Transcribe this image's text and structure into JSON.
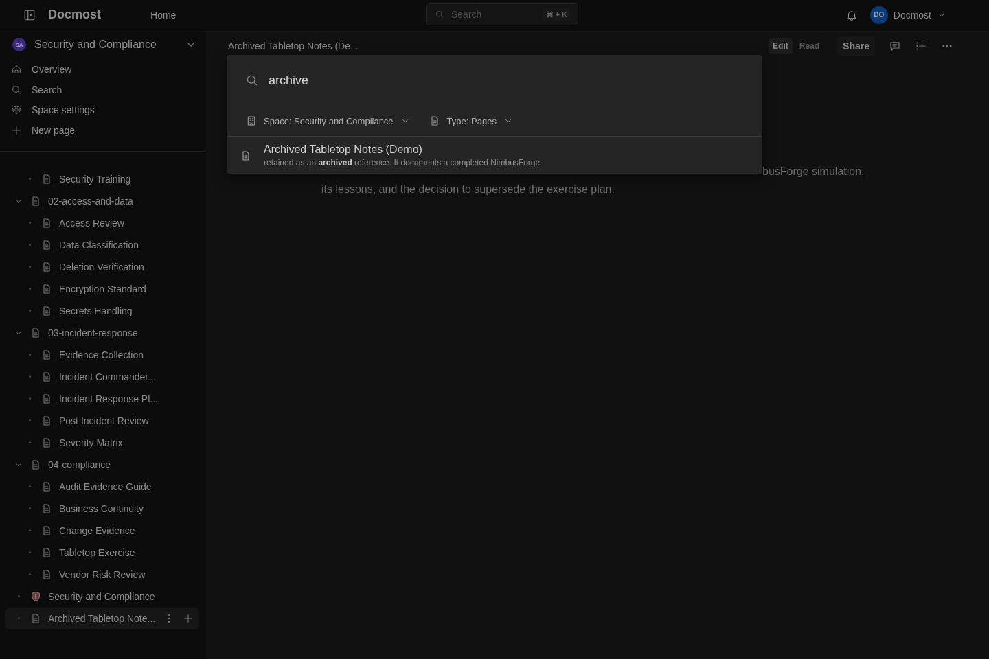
{
  "topbar": {
    "app_name": "Docmost",
    "nav": [
      {
        "label": "Home"
      }
    ],
    "search": {
      "placeholder": "Search",
      "shortcut": "⌘ + K"
    },
    "user": {
      "initials": "DO",
      "name": "Docmost"
    }
  },
  "sidebar": {
    "space": {
      "initials": "SA",
      "name": "Security and Compliance"
    },
    "nav": [
      {
        "kind": "home",
        "label": "Overview"
      },
      {
        "kind": "search",
        "label": "Search"
      },
      {
        "kind": "settings",
        "label": "Space settings"
      },
      {
        "kind": "add",
        "label": "New page"
      }
    ],
    "tree": [
      {
        "children": [
          {
            "kind": "page",
            "title": "Security Training",
            "selected": false
          }
        ]
      },
      {
        "kind": "page",
        "title": "02-access-and-data",
        "expanded": true,
        "selected": false,
        "children": [
          {
            "kind": "page",
            "title": "Access Review",
            "selected": false
          },
          {
            "kind": "page",
            "title": "Data Classification",
            "selected": false
          },
          {
            "kind": "page",
            "title": "Deletion Verification",
            "selected": false
          },
          {
            "kind": "page",
            "title": "Encryption Standard",
            "selected": false
          },
          {
            "kind": "page",
            "title": "Secrets Handling",
            "selected": false
          }
        ]
      },
      {
        "kind": "page",
        "title": "03-incident-response",
        "expanded": true,
        "selected": false,
        "children": [
          {
            "kind": "page",
            "title": "Evidence Collection",
            "selected": false
          },
          {
            "kind": "page",
            "title": "Incident Commander...",
            "selected": false
          },
          {
            "kind": "page",
            "title": "Incident Response Pl...",
            "selected": false
          },
          {
            "kind": "page",
            "title": "Post Incident Review",
            "selected": false
          },
          {
            "kind": "page",
            "title": "Severity Matrix",
            "selected": false
          }
        ]
      },
      {
        "kind": "page",
        "title": "04-compliance",
        "expanded": true,
        "selected": false,
        "children": [
          {
            "kind": "page",
            "title": "Audit Evidence Guide",
            "selected": false
          },
          {
            "kind": "page",
            "title": "Business Continuity",
            "selected": false
          },
          {
            "kind": "page",
            "title": "Change Evidence",
            "selected": false
          },
          {
            "kind": "page",
            "title": "Tabletop Exercise",
            "selected": false
          },
          {
            "kind": "page",
            "title": "Vendor Risk Review",
            "selected": false
          }
        ]
      },
      {
        "kind": "shield",
        "title": "Security and Compliance",
        "selected": false
      },
      {
        "kind": "page",
        "title": "Archived Tabletop Note...",
        "selected": true
      }
    ]
  },
  "page": {
    "breadcrumb": "Archived Tabletop Notes (De...",
    "modes": [
      {
        "label": "Edit",
        "selected": true
      },
      {
        "label": "Read",
        "selected": false
      }
    ],
    "share": "Share",
    "body_lines": [
      "busForge simulation,",
      "its lessons, and the decision to supersede the exercise plan."
    ]
  },
  "search_modal": {
    "query": "archive",
    "filters": [
      {
        "kind": "space",
        "label": "Space: Security and Compliance"
      },
      {
        "kind": "type",
        "label": "Type: Pages"
      }
    ],
    "results": [
      {
        "title": "Archived Tabletop Notes (Demo)",
        "snippet": "retained as an **archived** reference. It documents a completed NimbusForge"
      }
    ]
  }
}
